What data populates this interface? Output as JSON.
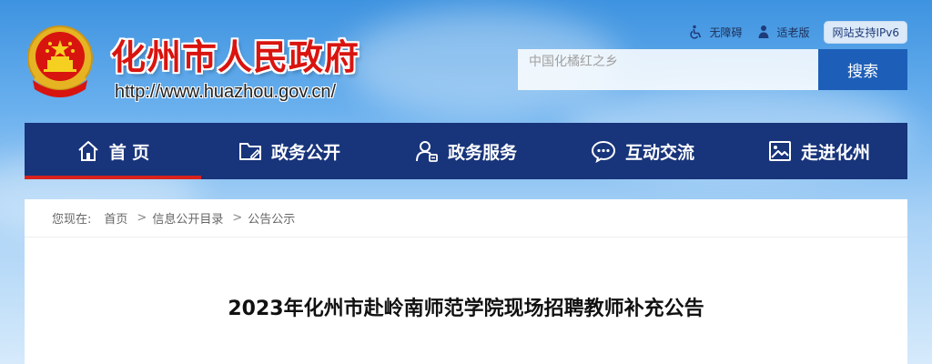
{
  "header": {
    "site_title": "化州市人民政府",
    "site_url": "http://www.huazhou.gov.cn/"
  },
  "toplinks": {
    "accessibility": "无障碍",
    "elderly": "适老版",
    "ipv6": "网站支持IPv6"
  },
  "search": {
    "placeholder": "中国化橘红之乡",
    "button": "搜索"
  },
  "nav": {
    "items": [
      {
        "label": "首 页",
        "icon": "home-icon"
      },
      {
        "label": "政务公开",
        "icon": "folder-icon"
      },
      {
        "label": "政务服务",
        "icon": "user-service-icon"
      },
      {
        "label": "互动交流",
        "icon": "chat-icon"
      },
      {
        "label": "走进化州",
        "icon": "picture-icon"
      }
    ]
  },
  "breadcrumb": {
    "prefix": "您现在:",
    "items": [
      "首页",
      "信息公开目录",
      "公告公示"
    ],
    "separator": ">"
  },
  "article": {
    "title": "2023年化州市赴岭南师范学院现场招聘教师补充公告"
  },
  "colors": {
    "nav_bg": "#18347a",
    "nav_active": "#d8221d",
    "search_button": "#1d5fb8",
    "title_red": "#d9140f"
  }
}
